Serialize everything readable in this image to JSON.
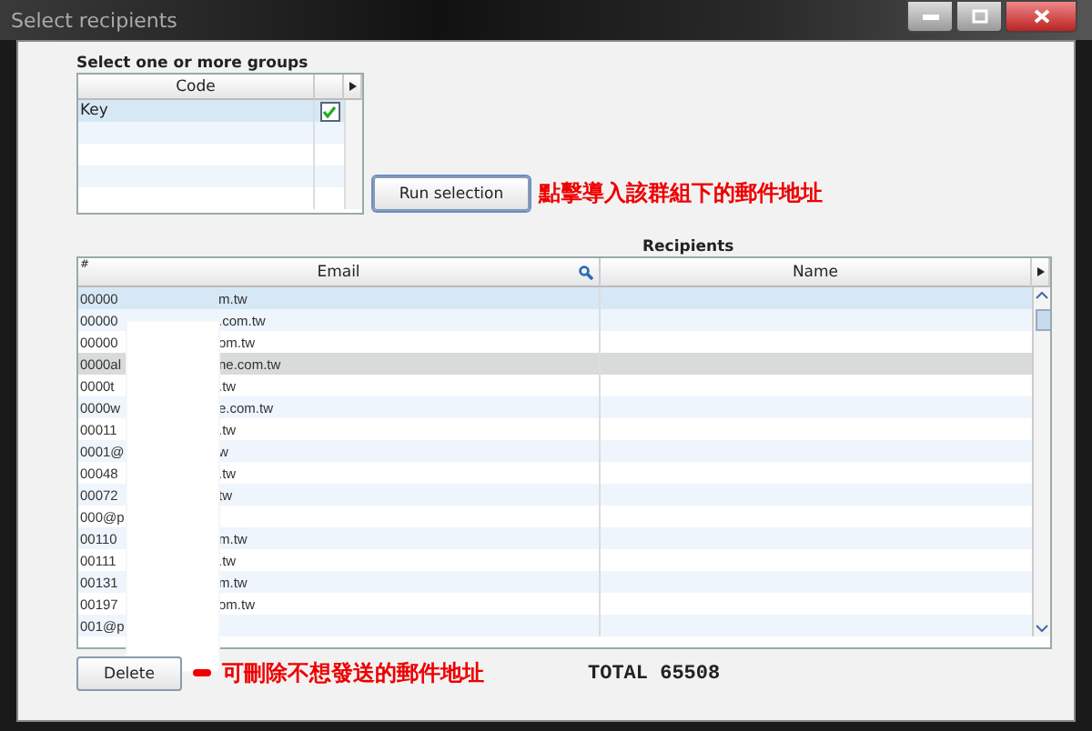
{
  "window": {
    "title": "Select recipients"
  },
  "groups": {
    "label": "Select one or more groups",
    "columns": [
      "Code"
    ],
    "rows": [
      {
        "code": "Key",
        "checked": true,
        "selected": true
      }
    ]
  },
  "run_button": {
    "label": "Run selection",
    "hint": "點擊導入該群組下的郵件地址"
  },
  "recipients": {
    "title": "Recipients",
    "columns": [
      {
        "label": "#"
      },
      {
        "label": "Email"
      },
      {
        "label": "Name"
      }
    ],
    "rows": [
      {
        "email_start": "00000",
        "email_end": "m.tw",
        "selected": true,
        "highlighted": false
      },
      {
        "email_start": "00000",
        "email_end": ".com.tw",
        "selected": false,
        "highlighted": false
      },
      {
        "email_start": "00000",
        "email_end": "om.tw",
        "selected": false,
        "highlighted": false
      },
      {
        "email_start": "0000al",
        "email_end": "ne.com.tw",
        "selected": false,
        "highlighted": true
      },
      {
        "email_start": "0000t",
        "email_end": ".tw",
        "selected": false,
        "highlighted": false
      },
      {
        "email_start": "0000w",
        "email_end": "e.com.tw",
        "selected": false,
        "highlighted": false
      },
      {
        "email_start": "00011",
        "email_end": ".tw",
        "selected": false,
        "highlighted": false
      },
      {
        "email_start": "0001@",
        "email_end": "w",
        "selected": false,
        "highlighted": false
      },
      {
        "email_start": "00048",
        "email_end": ".tw",
        "selected": false,
        "highlighted": false
      },
      {
        "email_start": "00072",
        "email_end": "tw",
        "selected": false,
        "highlighted": false
      },
      {
        "email_start": "000@p",
        "selected": false,
        "highlighted": false
      },
      {
        "email_start": "00110",
        "email_end": "m.tw",
        "selected": false,
        "highlighted": false
      },
      {
        "email_start": "00111",
        "email_end": ".tw",
        "selected": false,
        "highlighted": false
      },
      {
        "email_start": "00131",
        "email_end": "m.tw",
        "selected": false,
        "highlighted": false
      },
      {
        "email_start": "00197",
        "email_end": "om.tw",
        "selected": false,
        "highlighted": false
      },
      {
        "email_start": "001@p",
        "selected": false,
        "highlighted": false
      }
    ]
  },
  "delete_button": {
    "label": "Delete",
    "hint": "可刪除不想發送的郵件地址"
  },
  "total": "TOTAL 65508"
}
